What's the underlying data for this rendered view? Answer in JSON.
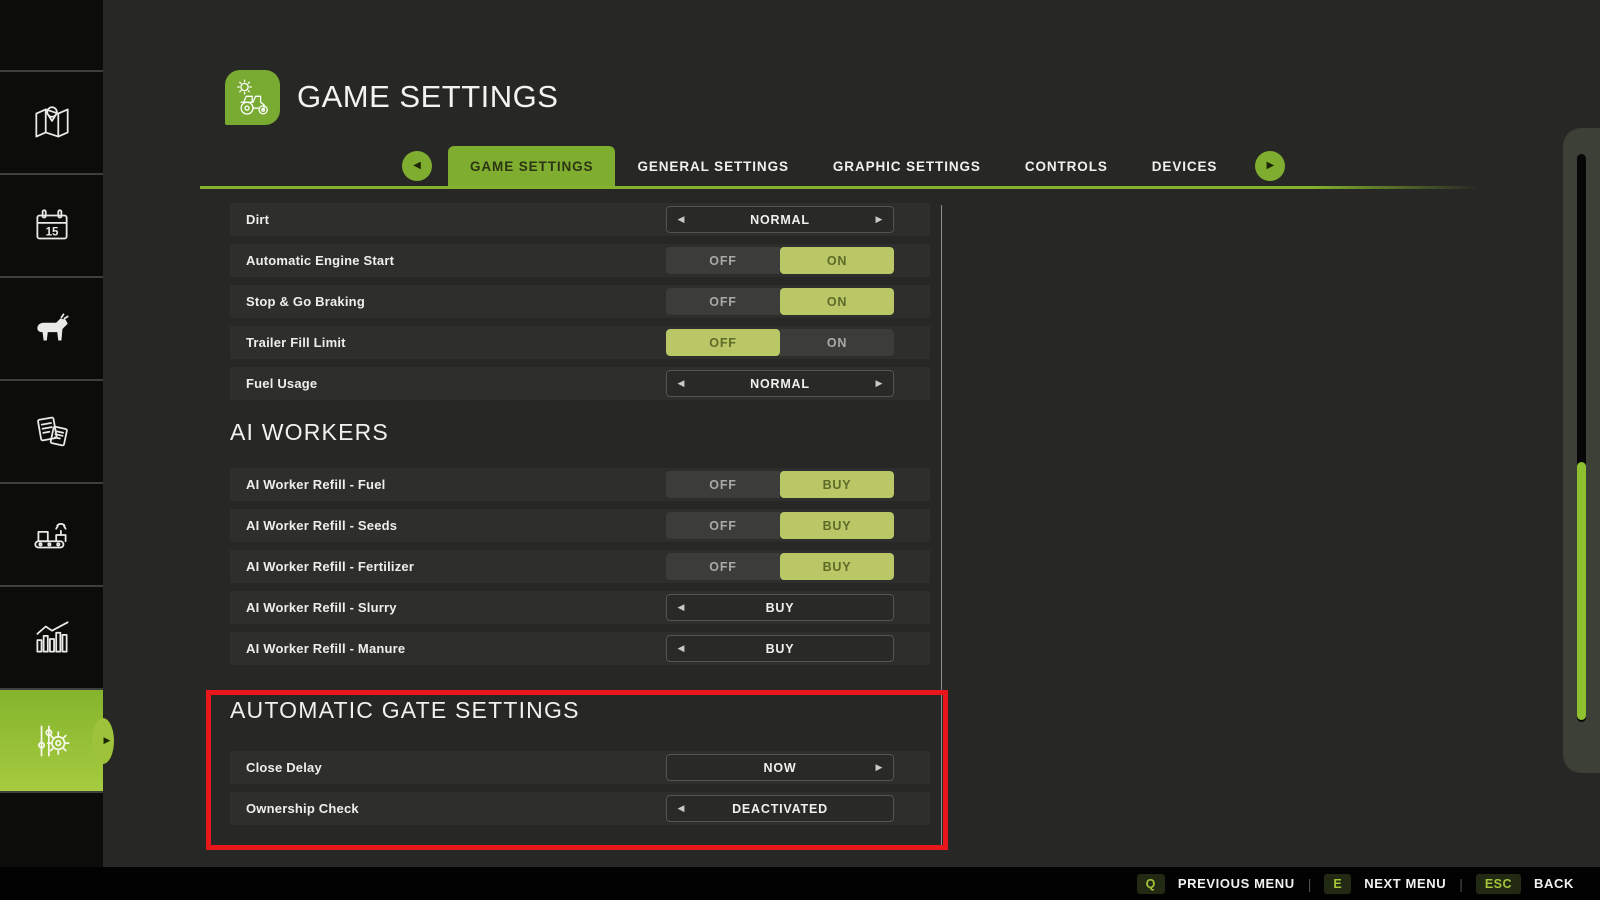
{
  "header": {
    "title": "GAME SETTINGS"
  },
  "tabs": [
    "GAME SETTINGS",
    "GENERAL SETTINGS",
    "GRAPHIC SETTINGS",
    "CONTROLS",
    "DEVICES"
  ],
  "active_tab": "GAME SETTINGS",
  "nav": {
    "prev_arrow": "◀",
    "next_arrow": "▶"
  },
  "sidebar": {
    "calendar_day": "15",
    "items": [
      {
        "name": "map",
        "icon": "map-icon"
      },
      {
        "name": "calendar",
        "icon": "calendar-icon"
      },
      {
        "name": "animals",
        "icon": "animals-icon"
      },
      {
        "name": "contracts",
        "icon": "contracts-icon"
      },
      {
        "name": "production",
        "icon": "production-icon"
      },
      {
        "name": "statistics",
        "icon": "statistics-icon"
      },
      {
        "name": "settings",
        "icon": "settings-icon",
        "active": true
      }
    ]
  },
  "sections": [
    {
      "title": "",
      "rows": [
        {
          "label": "Dirt",
          "type": "selector",
          "value": "NORMAL",
          "arrows": "both"
        },
        {
          "label": "Automatic Engine Start",
          "type": "toggle",
          "options": [
            "OFF",
            "ON"
          ],
          "active": 1
        },
        {
          "label": "Stop & Go Braking",
          "type": "toggle",
          "options": [
            "OFF",
            "ON"
          ],
          "active": 1
        },
        {
          "label": "Trailer Fill Limit",
          "type": "toggle",
          "options": [
            "OFF",
            "ON"
          ],
          "active": 0
        },
        {
          "label": "Fuel Usage",
          "type": "selector",
          "value": "NORMAL",
          "arrows": "both"
        }
      ]
    },
    {
      "title": "AI WORKERS",
      "rows": [
        {
          "label": "AI Worker Refill - Fuel",
          "type": "toggle",
          "options": [
            "OFF",
            "BUY"
          ],
          "active": 1
        },
        {
          "label": "AI Worker Refill - Seeds",
          "type": "toggle",
          "options": [
            "OFF",
            "BUY"
          ],
          "active": 1
        },
        {
          "label": "AI Worker Refill - Fertilizer",
          "type": "toggle",
          "options": [
            "OFF",
            "BUY"
          ],
          "active": 1
        },
        {
          "label": "AI Worker Refill - Slurry",
          "type": "selector",
          "value": "BUY",
          "arrows": "left"
        },
        {
          "label": "AI Worker Refill - Manure",
          "type": "selector",
          "value": "BUY",
          "arrows": "left"
        }
      ]
    },
    {
      "title": "AUTOMATIC GATE SETTINGS",
      "highlighted": true,
      "rows": [
        {
          "label": "Close Delay",
          "type": "selector",
          "value": "NOW",
          "arrows": "right"
        },
        {
          "label": "Ownership Check",
          "type": "selector",
          "value": "DEACTIVATED",
          "arrows": "left"
        }
      ]
    }
  ],
  "hotkeys": [
    {
      "key": "Q",
      "label": "PREVIOUS MENU"
    },
    {
      "key": "E",
      "label": "NEXT MENU"
    },
    {
      "key": "ESC",
      "label": "BACK"
    }
  ],
  "glyphs": {
    "left_arrow": "◀",
    "right_arrow": "▶"
  },
  "colors": {
    "accent_green": "#7ead2f",
    "toggle_active_green": "#bac766",
    "scroll_thumb_green": "#8fc02f",
    "annotation_red": "#e9171b"
  }
}
